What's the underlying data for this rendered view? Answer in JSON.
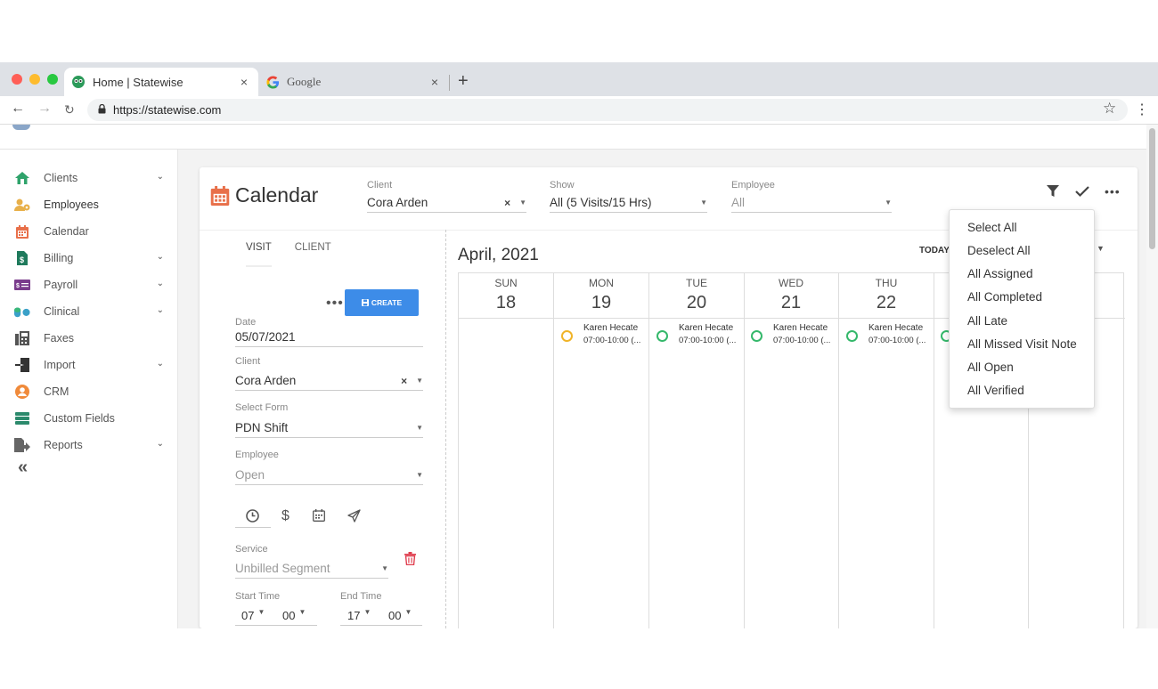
{
  "browser": {
    "tabs": [
      {
        "title": "Home | Statewise",
        "close": "×"
      },
      {
        "title": "Google",
        "close": "×"
      }
    ],
    "new_tab": "+",
    "url": "https://statewise.com"
  },
  "sidebar": {
    "items": [
      {
        "label": "Clients",
        "icon": "home-icon",
        "expandable": true
      },
      {
        "label": "Employees",
        "icon": "employees-icon",
        "expandable": false
      },
      {
        "label": "Calendar",
        "icon": "calendar-icon",
        "expandable": false
      },
      {
        "label": "Billing",
        "icon": "billing-icon",
        "expandable": true
      },
      {
        "label": "Payroll",
        "icon": "payroll-icon",
        "expandable": true
      },
      {
        "label": "Clinical",
        "icon": "clinical-icon",
        "expandable": true
      },
      {
        "label": "Faxes",
        "icon": "fax-icon",
        "expandable": false
      },
      {
        "label": "Import",
        "icon": "import-icon",
        "expandable": true
      },
      {
        "label": "CRM",
        "icon": "crm-icon",
        "expandable": false
      },
      {
        "label": "Custom Fields",
        "icon": "custom-fields-icon",
        "expandable": false
      },
      {
        "label": "Reports",
        "icon": "reports-icon",
        "expandable": true
      }
    ],
    "collapse": "«"
  },
  "header": {
    "title": "Calendar",
    "client": {
      "label": "Client",
      "value": "Cora Arden"
    },
    "show": {
      "label": "Show",
      "value": "All (5 Visits/15 Hrs)"
    },
    "employee": {
      "label": "Employee",
      "value": "All"
    }
  },
  "form": {
    "tabs": [
      "VISIT",
      "CLIENT"
    ],
    "more": "•••",
    "create_label": "CREATE",
    "date": {
      "label": "Date",
      "value": "05/07/2021"
    },
    "client": {
      "label": "Client",
      "value": "Cora Arden"
    },
    "select_form": {
      "label": "Select Form",
      "value": "PDN Shift"
    },
    "employee": {
      "label": "Employee",
      "value": "Open"
    },
    "service": {
      "label": "Service",
      "value": "Unbilled Segment"
    },
    "start_time": {
      "label": "Start Time",
      "hour": "07",
      "minute": "00"
    },
    "end_time": {
      "label": "End Time",
      "hour": "17",
      "minute": "00"
    }
  },
  "calendar": {
    "month": "April, 2021",
    "today_label": "TODAY",
    "days": [
      {
        "dow": "SUN",
        "num": "18"
      },
      {
        "dow": "MON",
        "num": "19"
      },
      {
        "dow": "TUE",
        "num": "20"
      },
      {
        "dow": "WED",
        "num": "21"
      },
      {
        "dow": "THU",
        "num": "22"
      },
      {
        "dow": "",
        "num": ""
      },
      {
        "dow": "",
        "num": ""
      }
    ],
    "events": [
      {
        "name": "Karen Hecate",
        "time": "07:00-10:00 (...",
        "status_color": "#f0b429"
      },
      {
        "name": "Karen Hecate",
        "time": "07:00-10:00 (...",
        "status_color": "#35b86b"
      },
      {
        "name": "Karen Hecate",
        "time": "07:00-10:00 (...",
        "status_color": "#35b86b"
      },
      {
        "name": "Karen Hecate",
        "time": "07:00-10:00 (...",
        "status_color": "#35b86b"
      }
    ]
  },
  "filter_menu": {
    "items": [
      "Select All",
      "Deselect All",
      "All Assigned",
      "All Completed",
      "All Late",
      "All Missed Visit Note",
      "All Open",
      "All Verified"
    ]
  },
  "colors": {
    "accent": "#3d8ce8",
    "calendar_icon": "#e8704a",
    "trash": "#e04050",
    "status_green": "#35b86b",
    "status_yellow": "#f0b429"
  }
}
